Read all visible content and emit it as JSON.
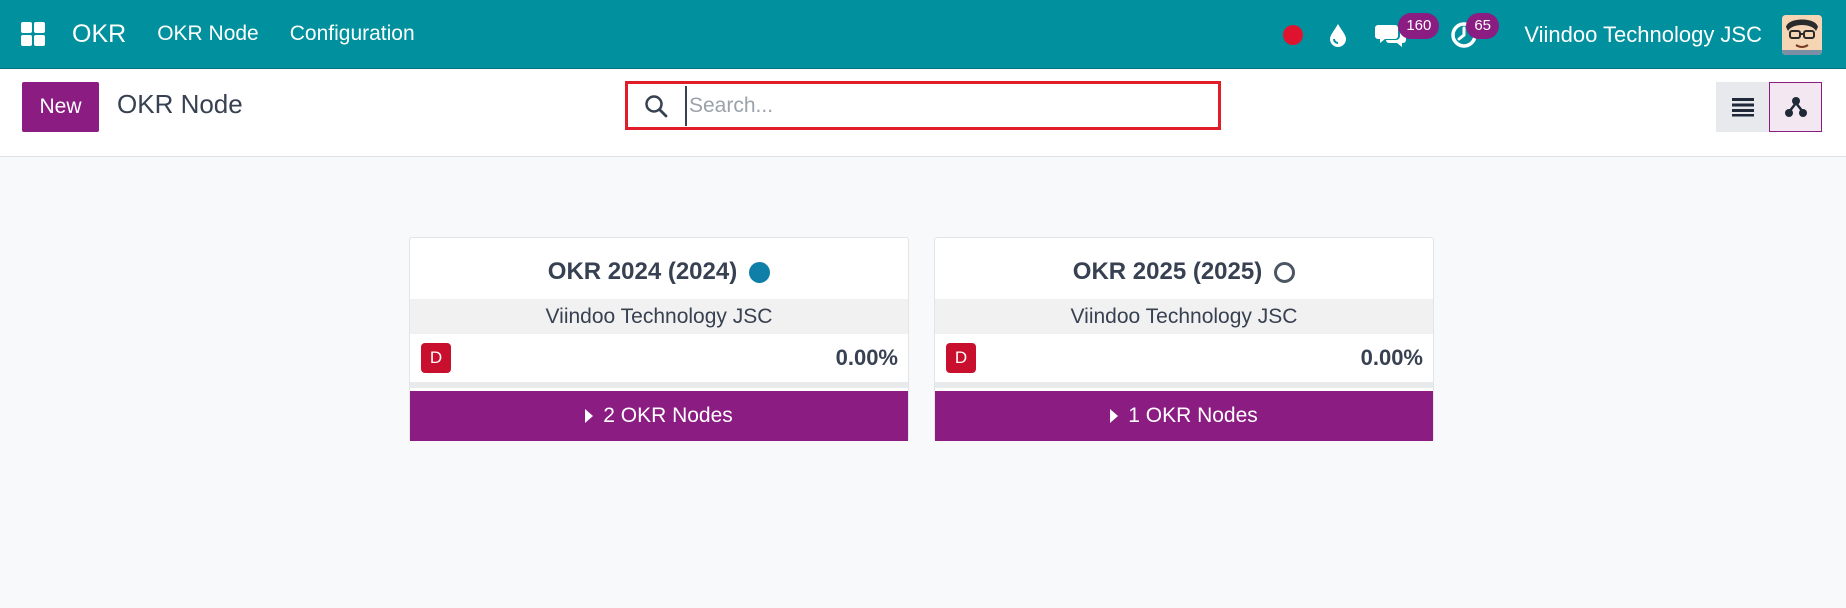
{
  "navbar": {
    "brand": "OKR",
    "menu": [
      "OKR Node",
      "Configuration"
    ],
    "messages_badge": "160",
    "activities_badge": "65",
    "company": "Viindoo Technology JSC",
    "colors": {
      "bar": "#00909e",
      "badge": "#8a1c82",
      "record": "#e0132f"
    }
  },
  "control_panel": {
    "new_label": "New",
    "title": "OKR Node",
    "search": {
      "placeholder": "Search...",
      "value": ""
    },
    "views": [
      "list-icon",
      "hierarchy-icon"
    ],
    "active_view": "hierarchy"
  },
  "cards": [
    {
      "title": "OKR 2024 (2024)",
      "status": "filled",
      "company": "Viindoo Technology JSC",
      "avatar_letter": "D",
      "progress": "0.00%",
      "children_label": "2 OKR Nodes"
    },
    {
      "title": "OKR 2025 (2025)",
      "status": "empty",
      "company": "Viindoo Technology JSC",
      "avatar_letter": "D",
      "progress": "0.00%",
      "children_label": "1 OKR Nodes"
    }
  ]
}
